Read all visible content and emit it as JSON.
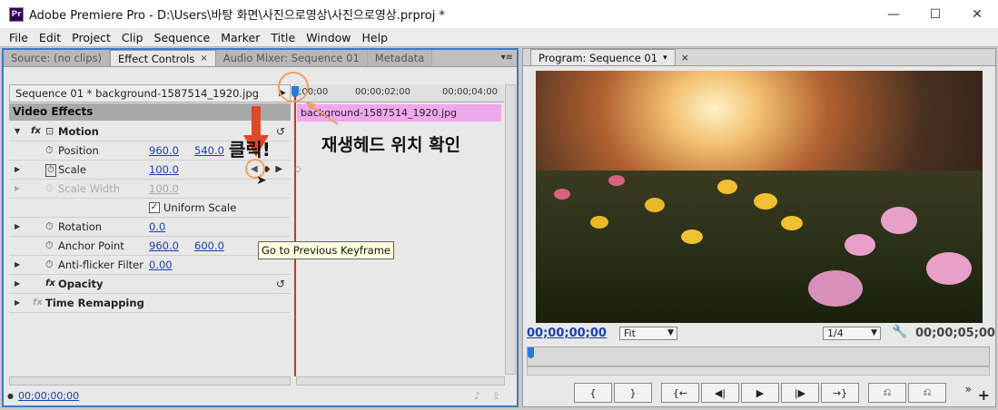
{
  "window": {
    "title": "Adobe Premiere Pro - D:\\Users\\바탕 화면\\사진으로영상\\사진으로영상.prproj *",
    "app_icon": "Pr",
    "controls": {
      "minimize": "—",
      "maximize": "☐",
      "close": "✕"
    }
  },
  "menu": [
    "File",
    "Edit",
    "Project",
    "Clip",
    "Sequence",
    "Marker",
    "Title",
    "Window",
    "Help"
  ],
  "left_panel": {
    "tabs": [
      {
        "label": "Source: (no clips)"
      },
      {
        "label": "Effect Controls",
        "active": true,
        "close": "×"
      },
      {
        "label": "Audio Mixer: Sequence 01"
      },
      {
        "label": "Metadata"
      }
    ],
    "clip_header": "Sequence 01 * background-1587514_1920.jpg",
    "section_label": "Video Effects",
    "rows": [
      {
        "id": "motion",
        "label": "Motion",
        "fx": "fx"
      },
      {
        "id": "position",
        "label": "Position",
        "v1": "960.0",
        "v2": "540.0"
      },
      {
        "id": "scale",
        "label": "Scale",
        "v1": "100.0"
      },
      {
        "id": "scale_width",
        "label": "Scale Width",
        "v1": "100.0"
      },
      {
        "id": "uniform",
        "label": "Uniform Scale"
      },
      {
        "id": "rotation",
        "label": "Rotation",
        "v1": "0.0"
      },
      {
        "id": "anchor",
        "label": "Anchor Point",
        "v1": "960.0",
        "v2": "600.0"
      },
      {
        "id": "antiflicker",
        "label": "Anti-flicker Filter",
        "v1": "0.00"
      },
      {
        "id": "opacity",
        "label": "Opacity",
        "fx": "fx"
      },
      {
        "id": "timeremap",
        "label": "Time Remapping",
        "fx": "fx"
      }
    ],
    "ruler": {
      "t0": ";00;00",
      "t1": "00;00;02;00",
      "t2": "00;00;04;00"
    },
    "clip_bar": "background-1587514_1920.jpg",
    "tooltip": "Go to Previous Keyframe",
    "annotation_click": "클릭!",
    "annotation_playhead": "재생헤드 위치 확인",
    "timecode": "00;00;00;00"
  },
  "right_panel": {
    "tab": "Program: Sequence 01",
    "tab_close": "×",
    "timecode_left": "00;00;00;00",
    "fit": "Fit",
    "resolution": "1/4",
    "timecode_right": "00;00;05;00",
    "transport": [
      "{",
      "}",
      "{←",
      "◀|",
      "▶",
      "|▶",
      "→}",
      "⎌",
      "⎌"
    ]
  },
  "colors": {
    "clip_bar": "#f0a8ec",
    "playhead": "#d23030",
    "timecode_blue": "#1a3fb0",
    "annotation_orange": "#f0a060",
    "active_border": "#3c78c8"
  }
}
